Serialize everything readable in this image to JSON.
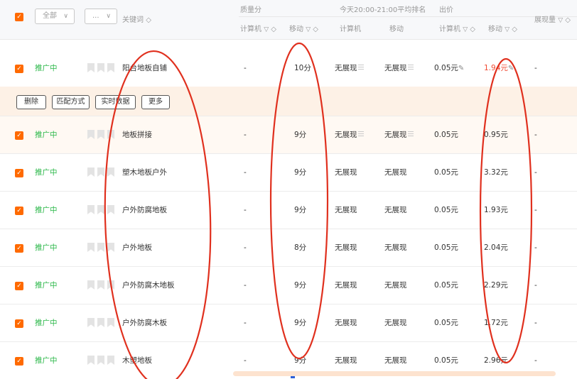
{
  "header": {
    "filter_all": "全部",
    "filter_more": "...",
    "keyword_col": "关键词",
    "quality_group": "质量分",
    "quality_pc": "计算机",
    "quality_mobile": "移动",
    "rank_group": "今天20:00-21:00平均排名",
    "rank_pc": "计算机",
    "rank_mobile": "移动",
    "bid_group": "出价",
    "bid_pc": "计算机",
    "bid_mobile": "移动",
    "impressions": "展现量"
  },
  "icons": {
    "sort": "◇",
    "funnel": "▽",
    "chevron": "∨",
    "pencil": "✎",
    "check": "✓"
  },
  "toolbar": {
    "delete": "删除",
    "match_type": "匹配方式",
    "realtime": "实时数据",
    "more": "更多"
  },
  "rows": [
    {
      "status": "推广中",
      "keyword": "阳台地板自铺",
      "q_pc": "-",
      "q_mobile": "10分",
      "rank_pc": "无展现",
      "rank_mobile": "无展现",
      "bid_pc": "0.05元",
      "bid_mobile": "1.94元",
      "impr": "-"
    },
    {
      "status": "推广中",
      "keyword": "地板拼接",
      "q_pc": "-",
      "q_mobile": "9分",
      "rank_pc": "无展现",
      "rank_mobile": "无展现",
      "bid_pc": "0.05元",
      "bid_mobile": "0.95元",
      "impr": "-"
    },
    {
      "status": "推广中",
      "keyword": "塑木地板户外",
      "q_pc": "-",
      "q_mobile": "9分",
      "rank_pc": "无展现",
      "rank_mobile": "无展现",
      "bid_pc": "0.05元",
      "bid_mobile": "3.32元",
      "impr": "-"
    },
    {
      "status": "推广中",
      "keyword": "户外防腐地板",
      "q_pc": "-",
      "q_mobile": "9分",
      "rank_pc": "无展现",
      "rank_mobile": "无展现",
      "bid_pc": "0.05元",
      "bid_mobile": "1.93元",
      "impr": "-"
    },
    {
      "status": "推广中",
      "keyword": "户外地板",
      "q_pc": "-",
      "q_mobile": "8分",
      "rank_pc": "无展现",
      "rank_mobile": "无展现",
      "bid_pc": "0.05元",
      "bid_mobile": "2.04元",
      "impr": "-"
    },
    {
      "status": "推广中",
      "keyword": "户外防腐木地板",
      "q_pc": "-",
      "q_mobile": "9分",
      "rank_pc": "无展现",
      "rank_mobile": "无展现",
      "bid_pc": "0.05元",
      "bid_mobile": "2.29元",
      "impr": "-"
    },
    {
      "status": "推广中",
      "keyword": "户外防腐木板",
      "q_pc": "-",
      "q_mobile": "9分",
      "rank_pc": "无展现",
      "rank_mobile": "无展现",
      "bid_pc": "0.05元",
      "bid_mobile": "1.72元",
      "impr": "-"
    },
    {
      "status": "推广中",
      "keyword": "木塑地板",
      "q_pc": "-",
      "q_mobile": "9分",
      "rank_pc": "无展现",
      "rank_mobile": "无展现",
      "bid_pc": "0.05元",
      "bid_mobile": "2.96元",
      "impr": "-"
    }
  ],
  "colors": {
    "accent": "#ff6a00",
    "status_green": "#2cb84a",
    "annotation_red": "#e0301e"
  }
}
